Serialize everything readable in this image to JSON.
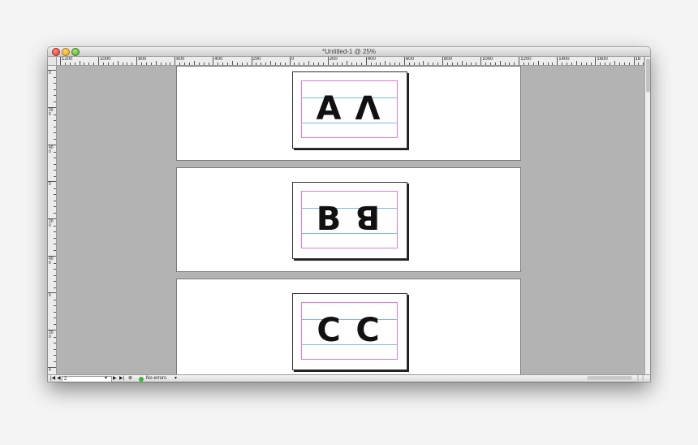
{
  "window": {
    "title": "*Untitled-1 @ 25%"
  },
  "rulers": {
    "horizontal_labels": [
      "1200",
      "1000",
      "800",
      "600",
      "400",
      "200",
      "0",
      "200",
      "400",
      "600",
      "800",
      "1000",
      "1200",
      "1400",
      "1600",
      "18"
    ],
    "vertical_labels": [
      "0",
      "200",
      "400",
      "0",
      "200",
      "400",
      "0",
      "200",
      "4"
    ]
  },
  "pages": [
    {
      "glyph_left": "A",
      "glyph_right": "Λ"
    },
    {
      "glyph_left": "B",
      "glyph_right": "ꓭ"
    },
    {
      "glyph_left": "C",
      "glyph_right": "C"
    }
  ],
  "status": {
    "first_page_icon": "first-page-icon",
    "prev_page_icon": "previous-page-icon",
    "page_number": "2",
    "next_page_icon": "next-page-icon",
    "last_page_icon": "last-page-icon",
    "preflight_text": "No errors",
    "preflight_color": "#3cb43c"
  }
}
